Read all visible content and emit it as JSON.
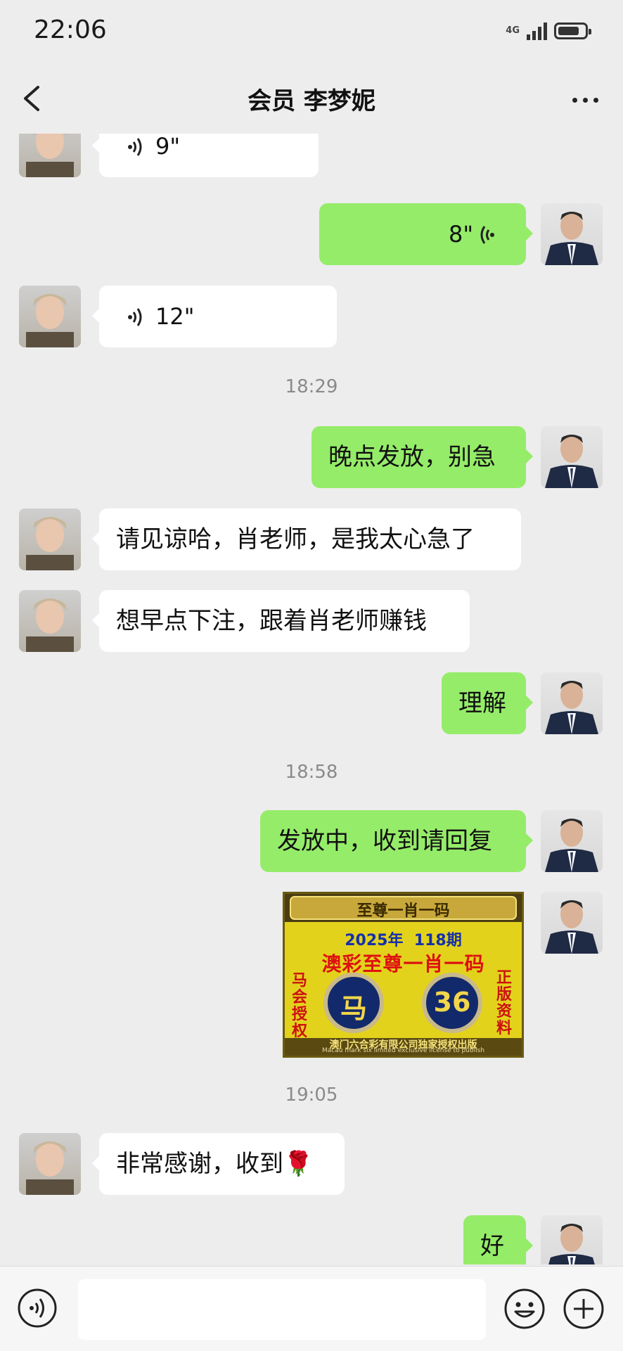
{
  "status": {
    "time": "22:06",
    "network": "4G",
    "battery_level": 0.8
  },
  "header": {
    "title": "会员 李梦妮"
  },
  "messages": {
    "voice1": "9\"",
    "voice2": "8\"",
    "voice3": "12\"",
    "time1": "18:29",
    "text1": "晚点发放，别急",
    "text2": "请见谅哈，肖老师，是我太心急了",
    "text3": "想早点下注，跟着肖老师赚钱",
    "text4": "理解",
    "time2": "18:58",
    "text5": "发放中，收到请回复",
    "time3": "19:05",
    "text6": "非常感谢，收到",
    "text6_emoji": "🌹",
    "text7": "好"
  },
  "image_card": {
    "top_title": "至尊一肖一码",
    "issue": "2025年  118期",
    "headline": "澳彩至尊一肖一码",
    "left_vertical": "马会授权",
    "right_vertical": "正版资料",
    "zodiac": "马",
    "number": "36",
    "footer_cn": "澳门六合彩有限公司独家授权出版",
    "footer_en": "Macau mark six limited exclusive license to publish"
  },
  "icons": {
    "back": "back-arrow-icon",
    "more": "more-icon",
    "voice": "voice-wave-icon",
    "emoji": "emoji-icon",
    "plus": "plus-icon"
  },
  "colors": {
    "outgoing_bubble": "#95ec69",
    "incoming_bubble": "#ffffff",
    "background": "#ededed"
  }
}
